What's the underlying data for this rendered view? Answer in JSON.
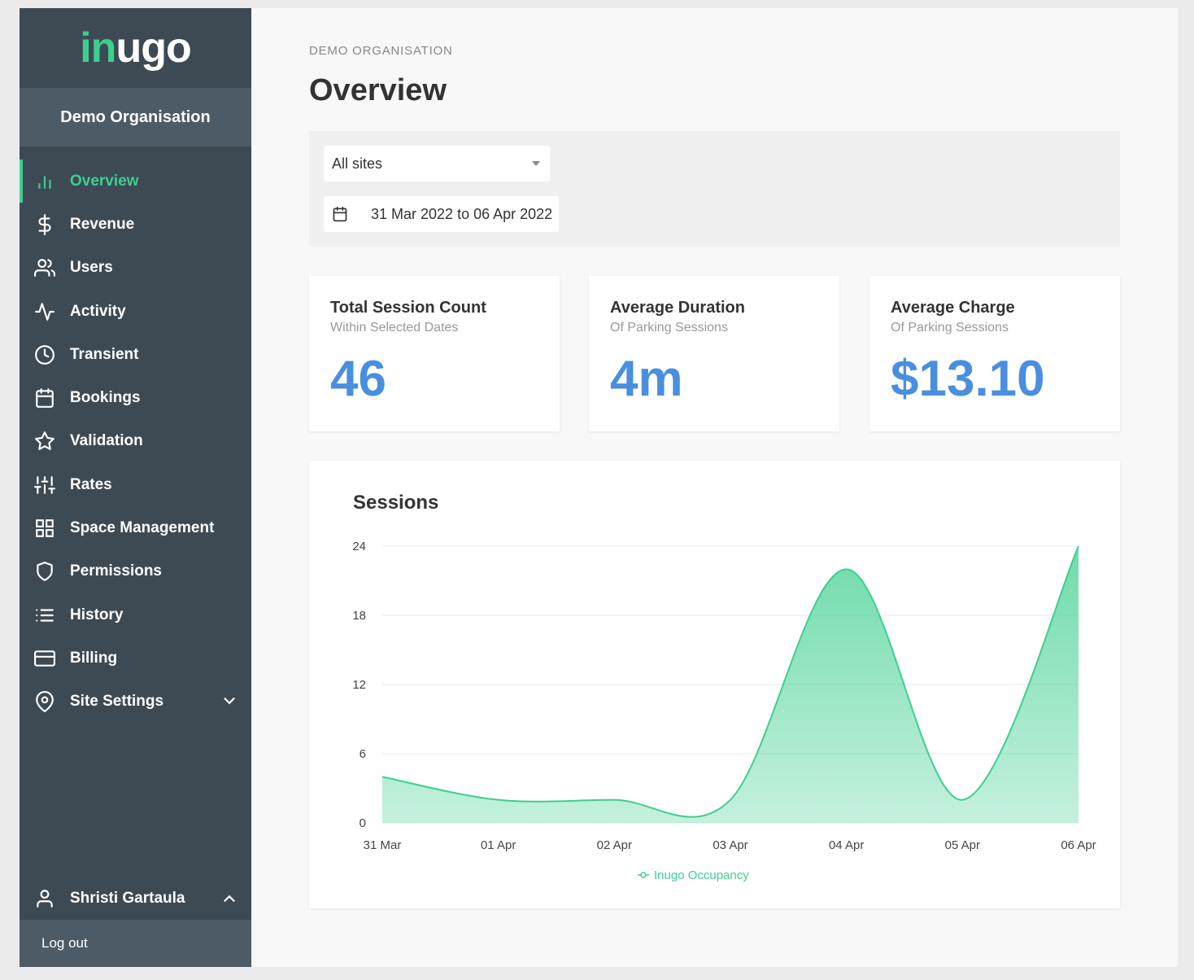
{
  "logo": {
    "part1": "in",
    "part2": "ugo"
  },
  "sidebar": {
    "org_name": "Demo Organisation",
    "items": [
      {
        "label": "Overview",
        "icon": "bar-chart-icon",
        "active": true
      },
      {
        "label": "Revenue",
        "icon": "dollar-icon"
      },
      {
        "label": "Users",
        "icon": "users-icon"
      },
      {
        "label": "Activity",
        "icon": "activity-icon"
      },
      {
        "label": "Transient",
        "icon": "clock-icon"
      },
      {
        "label": "Bookings",
        "icon": "calendar-icon"
      },
      {
        "label": "Validation",
        "icon": "star-icon"
      },
      {
        "label": "Rates",
        "icon": "sliders-icon"
      },
      {
        "label": "Space Management",
        "icon": "grid-icon"
      },
      {
        "label": "Permissions",
        "icon": "shield-icon"
      },
      {
        "label": "History",
        "icon": "list-icon"
      },
      {
        "label": "Billing",
        "icon": "credit-card-icon"
      },
      {
        "label": "Site Settings",
        "icon": "map-pin-icon"
      }
    ],
    "user_name": "Shristi Gartaula",
    "logout": "Log out"
  },
  "header": {
    "breadcrumb": "DEMO ORGANISATION",
    "title": "Overview"
  },
  "filters": {
    "site": "All sites",
    "date_range": "31 Mar 2022 to 06 Apr 2022"
  },
  "cards": [
    {
      "title": "Total Session Count",
      "subtitle": "Within Selected Dates",
      "value": "46"
    },
    {
      "title": "Average Duration",
      "subtitle": "Of Parking Sessions",
      "value": "4m"
    },
    {
      "title": "Average Charge",
      "subtitle": "Of Parking Sessions",
      "value": "$13.10"
    }
  ],
  "colors": {
    "accent": "#3ecf8e",
    "value_blue": "#4a8fde",
    "sidebar": "#3d4a54"
  },
  "chart_data": {
    "type": "area",
    "title": "Sessions",
    "x": [
      "31 Mar",
      "01 Apr",
      "02 Apr",
      "03 Apr",
      "04 Apr",
      "05 Apr",
      "06 Apr"
    ],
    "series": [
      {
        "name": "Inugo Occupancy",
        "values": [
          4,
          2,
          2,
          2,
          22,
          2,
          24
        ]
      }
    ],
    "yticks": [
      0,
      6,
      12,
      18,
      24
    ],
    "ylim": [
      0,
      24
    ],
    "grid": true,
    "legend": "bottom"
  }
}
